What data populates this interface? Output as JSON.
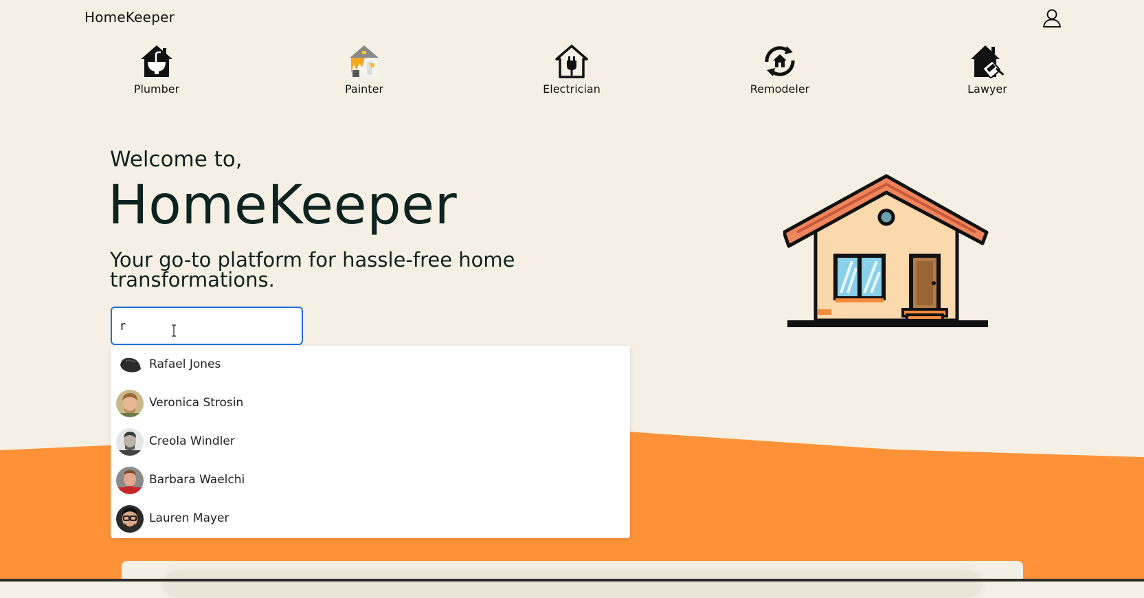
{
  "app": {
    "brand": "HomeKeeper"
  },
  "categories": [
    {
      "label": "Plumber",
      "icon": "plumber-house-icon"
    },
    {
      "label": "Painter",
      "icon": "painter-house-icon"
    },
    {
      "label": "Electrician",
      "icon": "electrician-house-icon"
    },
    {
      "label": "Remodeler",
      "icon": "remodeler-refresh-icon"
    },
    {
      "label": "Lawyer",
      "icon": "lawyer-house-icon"
    }
  ],
  "hero": {
    "welcome": "Welcome to,",
    "title": "HomeKeeper",
    "tagline": "Your go-to platform for hassle-free home transformations."
  },
  "search": {
    "value": "r",
    "placeholder": ""
  },
  "dropdown": {
    "items": [
      {
        "name": "Rafael Jones"
      },
      {
        "name": "Veronica Strosin"
      },
      {
        "name": "Creola Windler"
      },
      {
        "name": "Barbara Waelchi"
      },
      {
        "name": "Lauren Mayer"
      }
    ]
  },
  "colors": {
    "background": "#f6f0e4",
    "accent_orange": "#ff9238",
    "text_dark": "#0d2320",
    "focus_blue": "#1f6fe0"
  }
}
